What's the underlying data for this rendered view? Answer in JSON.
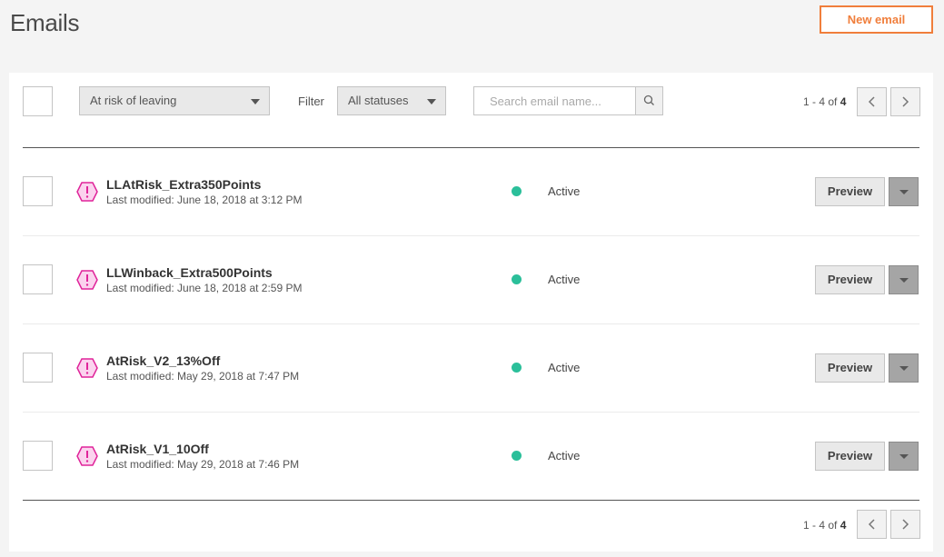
{
  "header": {
    "title": "Emails",
    "new_email_label": "New email"
  },
  "toolbar": {
    "segment_value": "At risk of leaving",
    "filter_label": "Filter",
    "status_value": "All statuses",
    "search_placeholder": "Search email name..."
  },
  "pagination": {
    "range": "1 - 4 of",
    "total": "4"
  },
  "colors": {
    "accent": "#f07e3b",
    "warning_icon": "#e0249a",
    "active_dot": "#2bbf9a"
  },
  "emails": [
    {
      "name": "LLAtRisk_Extra350Points",
      "modified": "Last modified: June 18, 2018 at 3:12 PM",
      "status": "Active",
      "preview_label": "Preview",
      "icon": "warning-icon"
    },
    {
      "name": "LLWinback_Extra500Points",
      "modified": "Last modified: June 18, 2018 at 2:59 PM",
      "status": "Active",
      "preview_label": "Preview",
      "icon": "warning-icon"
    },
    {
      "name": "AtRisk_V2_13%Off",
      "modified": "Last modified: May 29, 2018 at 7:47 PM",
      "status": "Active",
      "preview_label": "Preview",
      "icon": "warning-icon"
    },
    {
      "name": "AtRisk_V1_10Off",
      "modified": "Last modified: May 29, 2018 at 7:46 PM",
      "status": "Active",
      "preview_label": "Preview",
      "icon": "warning-icon"
    }
  ]
}
